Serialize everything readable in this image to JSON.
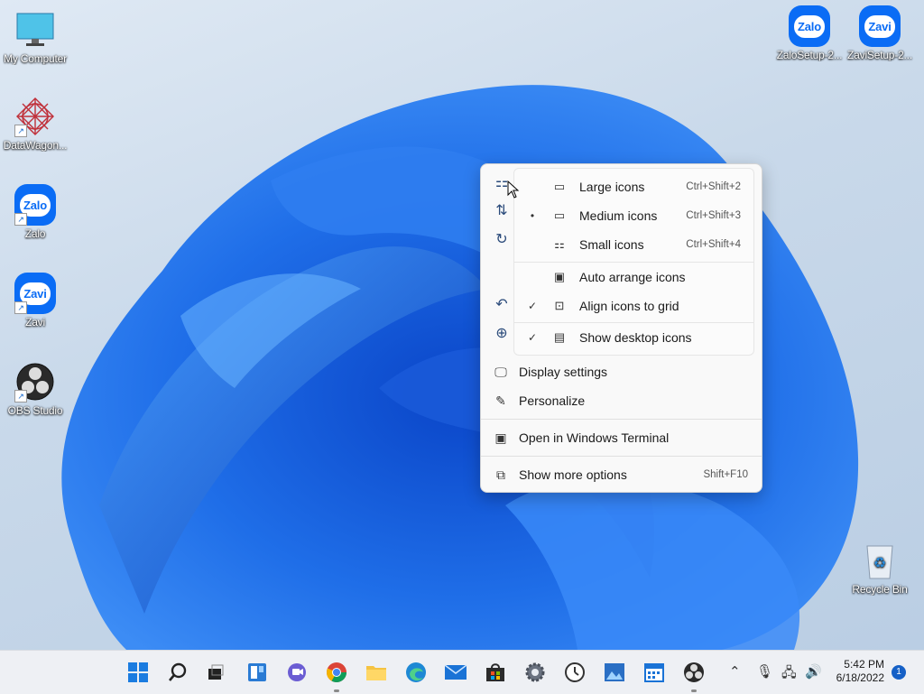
{
  "desktop": {
    "left_icons": [
      {
        "label": "My Computer",
        "icon": "monitor-icon"
      },
      {
        "label": "DataWagon...",
        "icon": "datawagon-icon"
      },
      {
        "label": "Zalo",
        "icon": "zalo-icon"
      },
      {
        "label": "Zavi",
        "icon": "zavi-icon"
      },
      {
        "label": "OBS Studio",
        "icon": "obs-icon"
      }
    ],
    "right_icons": [
      {
        "label": "ZaloSetup-2...",
        "icon": "zalo-setup-icon"
      },
      {
        "label": "ZaviSetup-2...",
        "icon": "zavi-setup-icon"
      },
      {
        "label": "Recycle Bin",
        "icon": "recycle-bin-icon"
      }
    ],
    "zalo_text": "Zalo",
    "zavi_text": "Zavi"
  },
  "context_menu": {
    "side_icons": [
      "view-grid-icon",
      "sort-icon",
      "refresh-icon",
      "undo-icon",
      "new-icon"
    ],
    "view_submenu": [
      {
        "mark": "",
        "icon": "large-icons-icon",
        "label": "Large icons",
        "shortcut": "Ctrl+Shift+2"
      },
      {
        "mark": "•",
        "icon": "medium-icons-icon",
        "label": "Medium icons",
        "shortcut": "Ctrl+Shift+3"
      },
      {
        "mark": "",
        "icon": "small-icons-icon",
        "label": "Small icons",
        "shortcut": "Ctrl+Shift+4"
      },
      {
        "mark": "",
        "icon": "auto-arrange-icon",
        "label": "Auto arrange icons",
        "shortcut": ""
      },
      {
        "mark": "✓",
        "icon": "align-grid-icon",
        "label": "Align icons to grid",
        "shortcut": ""
      },
      {
        "mark": "✓",
        "icon": "show-desktop-icon",
        "label": "Show desktop icons",
        "shortcut": ""
      }
    ],
    "items": [
      {
        "icon": "display-settings-icon",
        "label": "Display settings",
        "shortcut": ""
      },
      {
        "icon": "personalize-icon",
        "label": "Personalize",
        "shortcut": ""
      },
      {
        "icon": "terminal-icon",
        "label": "Open in Windows Terminal",
        "shortcut": ""
      },
      {
        "icon": "more-options-icon",
        "label": "Show more options",
        "shortcut": "Shift+F10"
      }
    ]
  },
  "taskbar": {
    "apps": [
      "start-icon",
      "search-icon",
      "task-view-icon",
      "widgets-icon",
      "teams-chat-icon",
      "chrome-icon",
      "file-explorer-icon",
      "edge-icon",
      "mail-icon",
      "store-icon",
      "settings-icon",
      "clock-app-icon",
      "photos-icon",
      "calendar-icon",
      "obs-taskbar-icon"
    ],
    "clock_time": "5:42 PM",
    "clock_date": "6/18/2022",
    "notification_count": "1"
  }
}
